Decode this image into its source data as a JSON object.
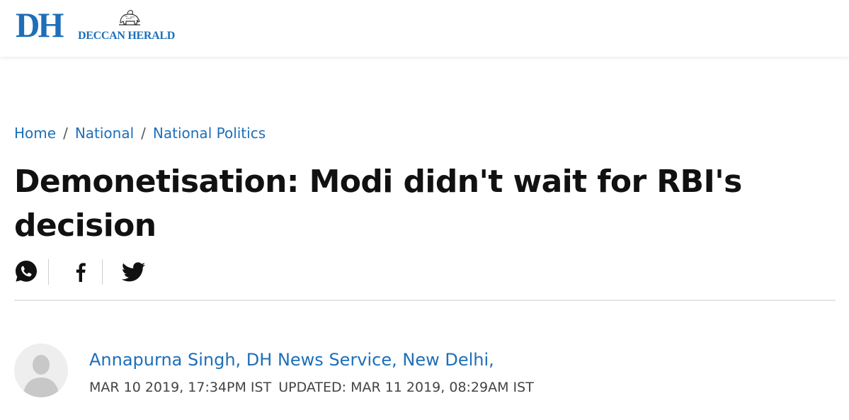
{
  "site": {
    "logo_mark": "DH",
    "logo_name": "DECCAN HERALD",
    "brand_color": "#1d6fb8",
    "emblem_icon": "elephant-emblem-icon"
  },
  "breadcrumb": {
    "items": [
      "Home",
      "National",
      "National Politics"
    ],
    "separator": "/"
  },
  "article": {
    "title": "Demonetisation: Modi didn't wait for RBI's decision",
    "author_line": "Annapurna Singh, DH News Service, New Delhi,",
    "published": "MAR 10 2019, 17:34PM IST",
    "updated": "UPDATED: MAR 11 2019, 08:29AM IST"
  },
  "share": {
    "icons": [
      "whatsapp-icon",
      "facebook-icon",
      "twitter-icon"
    ]
  },
  "colors": {
    "link": "#1d6fb8",
    "title": "#111111",
    "meta": "#444444"
  }
}
